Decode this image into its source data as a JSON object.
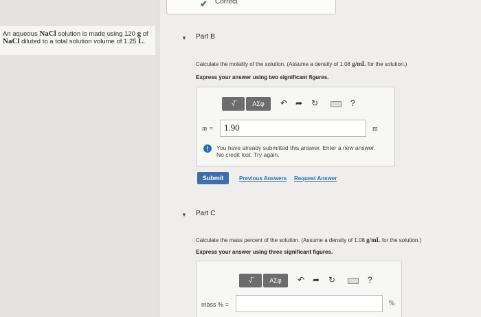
{
  "feedback": {
    "icon": "check-icon",
    "label": "Correct"
  },
  "problem": {
    "line1_pre": "An aqueous ",
    "line1_chem": "NaCl",
    "line1_post": " solution is made using 120 ",
    "line1_unit": "g",
    "line1_end": " of",
    "line2_chem": "NaCl",
    "line2_post": " diluted to a total solution volume of 1.25 ",
    "line2_unit": "L",
    "line2_end": "."
  },
  "partB": {
    "title": "Part B",
    "prompt_pre": "Calculate the molality of the solution. (Assume a density of 1.08 ",
    "prompt_unit": "g/mL",
    "prompt_post": " for the solution.)",
    "instruction": "Express your answer using two significant figures.",
    "variable": "m =",
    "value": "1.90",
    "unit": "m",
    "warning_line1": "You have already submitted this answer. Enter a new answer.",
    "warning_line2": "No credit lost. Try again.",
    "submit_label": "Submit",
    "prev_answers_label": "Previous Answers",
    "request_answer_label": "Request Answer"
  },
  "partC": {
    "title": "Part C",
    "prompt_pre": "Calculate the mass percent of the solution. (Assume a density of 1.08 ",
    "prompt_unit": "g/mL",
    "prompt_post": " for the solution.)",
    "instruction": "Express your answer using three significant figures.",
    "variable": "mass % =",
    "value": "",
    "unit": "%"
  },
  "toolbar": {
    "templates_label": "√̅",
    "symbols_label": "AΣφ",
    "undo_icon": "undo-icon",
    "redo_icon": "redo-icon",
    "reset_icon": "reset-icon",
    "keyboard_icon": "keyboard-icon",
    "help_label": "?"
  },
  "colors": {
    "accent": "#3d6fa8",
    "success": "#3b8b3b",
    "link": "#2e6fb0"
  }
}
